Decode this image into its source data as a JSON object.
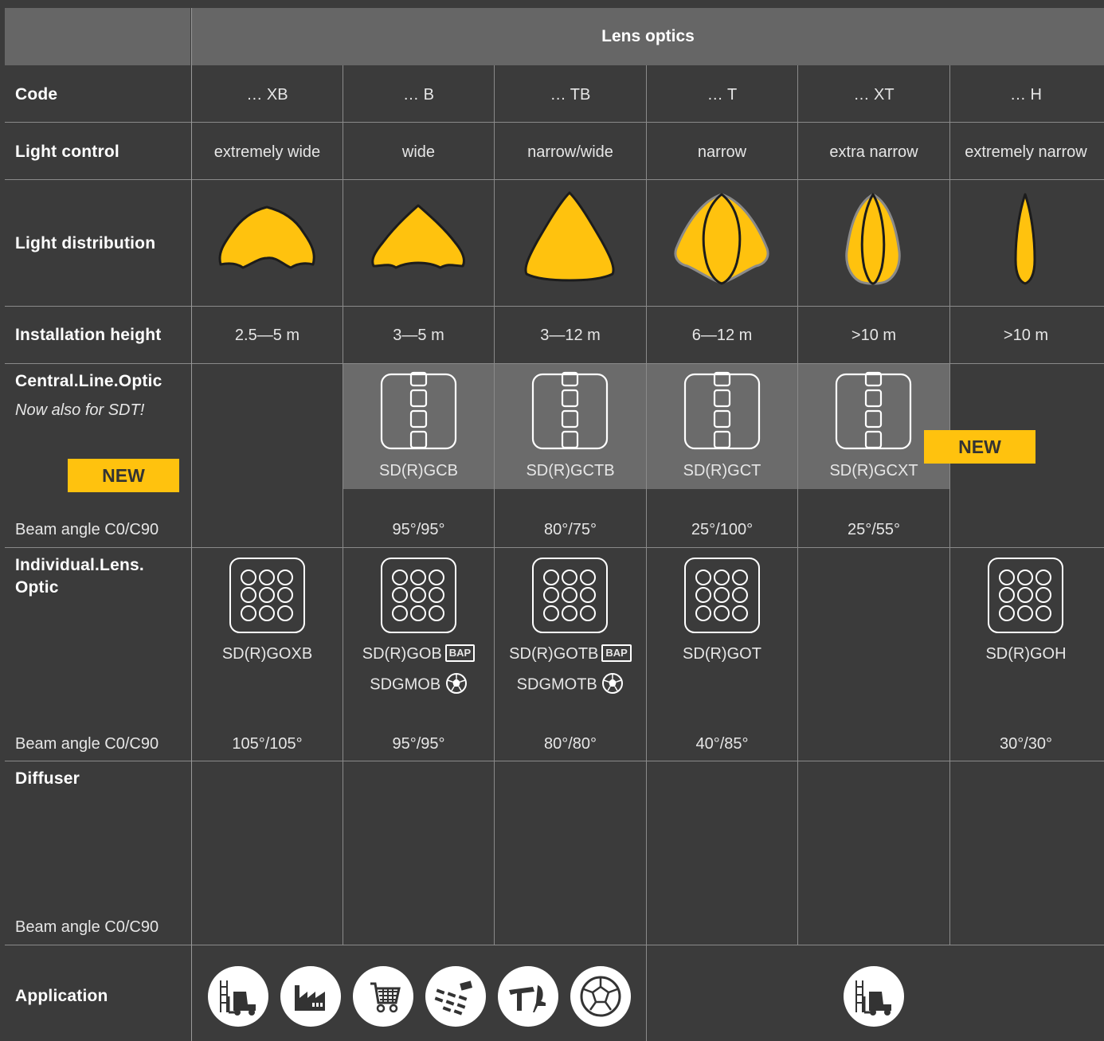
{
  "header": {
    "title": "Lens optics"
  },
  "rows": {
    "code": "Code",
    "light_control": "Light control",
    "light_distribution": "Light distribution",
    "installation_height": "Installation height",
    "central_line_optic": "Central.Line.Optic",
    "central_line_optic_sub": "Now also for SDT!",
    "individual_lens_optic_1": "Individual.Lens.",
    "individual_lens_optic_2": "Optic",
    "diffuser": "Diffuser",
    "application": "Application",
    "beam_angle": "Beam angle C0/C90"
  },
  "badges": {
    "new": "NEW",
    "bap": "BAP"
  },
  "codes": [
    "… XB",
    "… B",
    "… TB",
    "… T",
    "… XT",
    "… H"
  ],
  "light_control": [
    "extremely wide",
    "wide",
    "narrow/wide",
    "narrow",
    "extra narrow",
    "extremely narrow"
  ],
  "installation_height": [
    "2.5—5 m",
    "3—5 m",
    "3—12 m",
    "6—12 m",
    ">10 m",
    ">10 m"
  ],
  "central_line": {
    "products": [
      "SD(R)GCB",
      "SD(R)GCTB",
      "SD(R)GCT",
      "SD(R)GCXT"
    ],
    "beam_angles": [
      "95°/95°",
      "80°/75°",
      "25°/100°",
      "25°/55°"
    ]
  },
  "individual_lens": {
    "products": [
      "SD(R)GOXB",
      "SD(R)GOB",
      "SD(R)GOTB",
      "SD(R)GOT",
      "SD(R)GOH"
    ],
    "secondary": [
      "SDGMOB",
      "SDGMOTB"
    ],
    "beam_angles": [
      "105°/105°",
      "95°/95°",
      "80°/80°",
      "40°/85°",
      "30°/30°"
    ]
  },
  "application_icons": [
    "forklift-icon",
    "factory-icon",
    "shopping-cart-icon",
    "classroom-icon",
    "office-icon",
    "football-icon",
    "forklift-icon"
  ],
  "colors": {
    "background": "#3b3b3b",
    "header": "#666666",
    "accent": "#ffc20e",
    "highlight": "#6b6b6b"
  }
}
